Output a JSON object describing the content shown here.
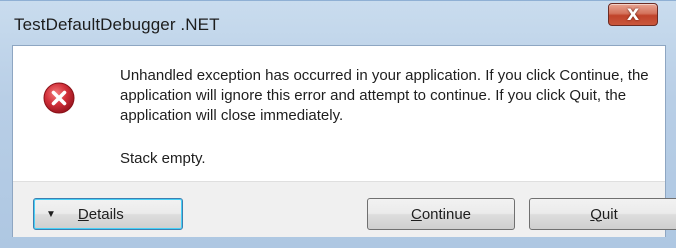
{
  "window": {
    "title": "TestDefaultDebugger .NET",
    "close_glyph": "X"
  },
  "dialog": {
    "icon": "error-icon",
    "message": "Unhandled exception has occurred in your application. If you click Continue, the application will ignore this error and attempt to continue. If you click Quit, the application will close immediately.",
    "stack_text": "Stack empty."
  },
  "buttons": {
    "details_label": "Details",
    "continue_label": "Continue",
    "quit_label": "Quit"
  },
  "colors": {
    "error_red": "#c4262e",
    "titlebar_blue": "#b8cee6",
    "close_red": "#c0432a"
  }
}
